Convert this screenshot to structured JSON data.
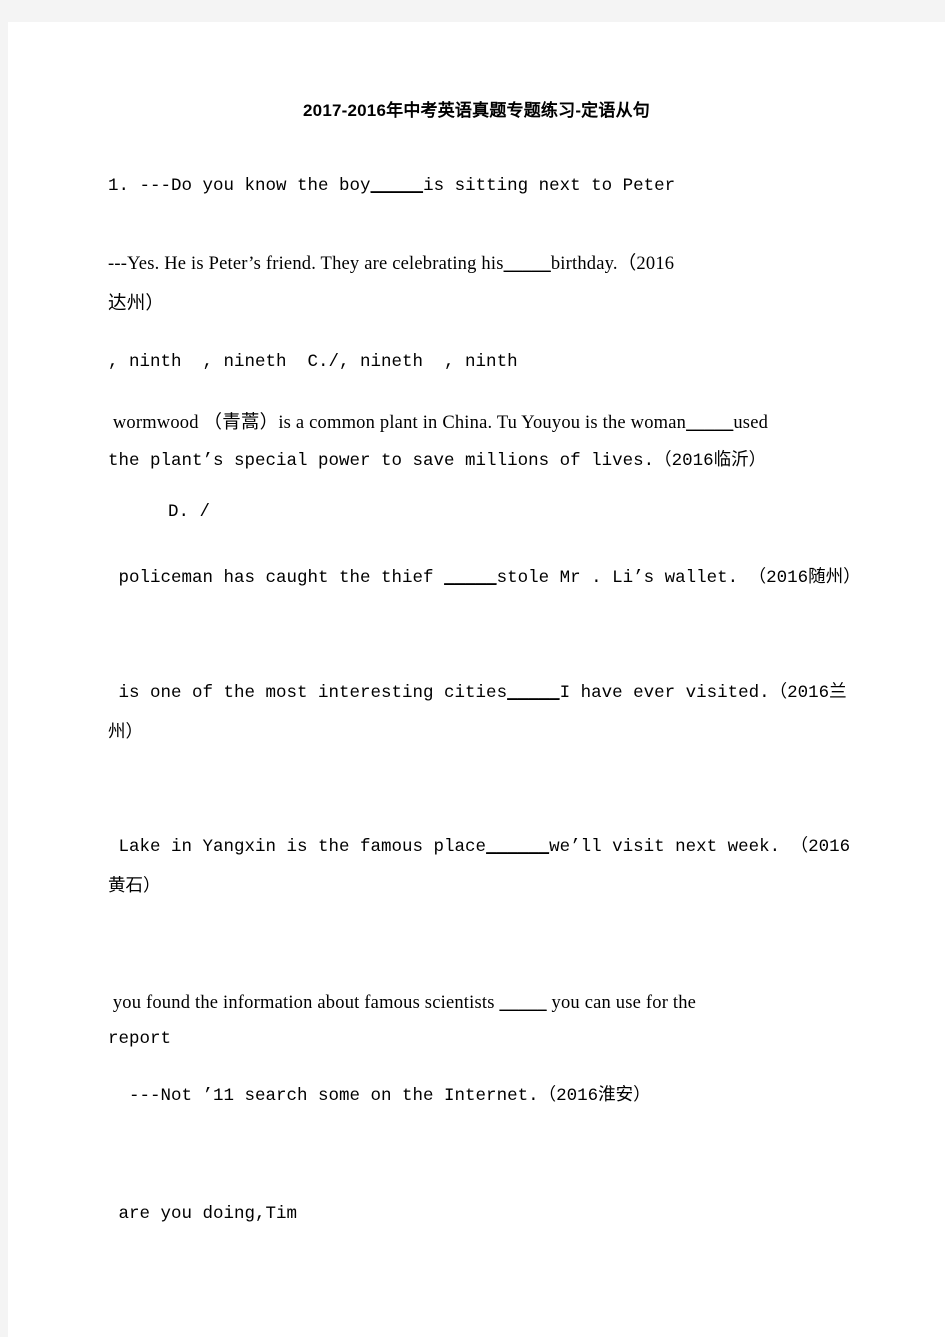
{
  "document": {
    "title": "2017-2016年中考英语真题专题练习-定语从句",
    "page_background": "#ffffff",
    "frame_color": "#f4f4f4",
    "text_color": "#000000"
  },
  "lines": {
    "q1_line1": "1. ---Do you know the boy",
    "q1_line1_blank": "_____",
    "q1_line1_tail": "is sitting next to Peter",
    "q1_line2_head": "---Yes. He is Peter’s friend. They are celebrating his",
    "q1_line2_blank": "_____",
    "q1_line2_tail": "birthday.（2016",
    "q1_line3": "达州）",
    "q1_options": ", ninth  , nineth  C./, nineth  , ninth",
    "q2_line1_head": " wormwood （青蒿）is a common plant in China. Tu Youyou is the woman",
    "q2_line1_blank": "_____",
    "q2_line1_tail": "used",
    "q2_line2": "the plant’s special power to save millions of lives.（2016临沂）",
    "q2_option_d": "D. /",
    "q3_head": " policeman has caught the thief ",
    "q3_blank": "_____",
    "q3_tail": "stole Mr . Li’s wallet. （2016随州）",
    "q4_line1_head": " is one of the most interesting cities",
    "q4_line1_blank": "_____",
    "q4_line1_tail": "I have ever visited.（2016兰",
    "q4_line2": "州）",
    "q5_line1_head": " Lake in Yangxin is the famous place",
    "q5_line1_blank": "______",
    "q5_line1_tail": "we’ll visit next week. （2016",
    "q5_line2": "黄石）",
    "q6_line1_head": " you found the information about famous scientists ",
    "q6_line1_blank": "_____",
    "q6_line1_tail": " you can use for the",
    "q6_line2": "report",
    "q6_line3": "  ---Not ’11 search some on the Internet.（2016淮安）",
    "q7_line1": " are you doing,Tim"
  }
}
